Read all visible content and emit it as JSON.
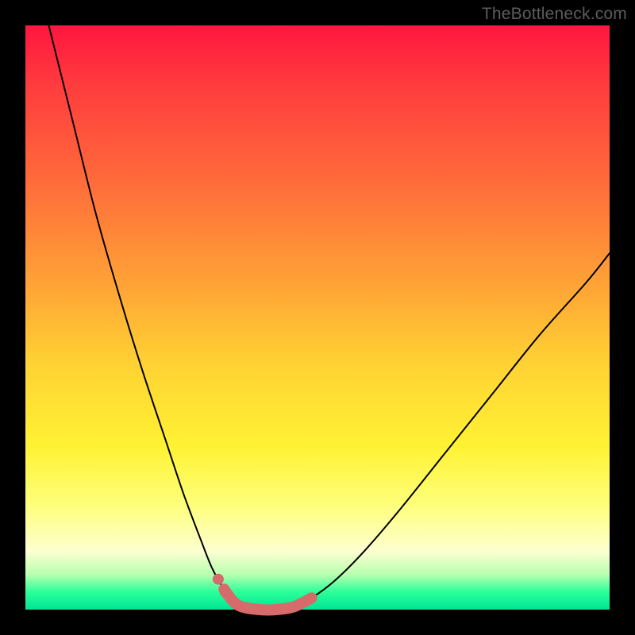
{
  "watermark": "TheBottleneck.com",
  "colors": {
    "frame_bg": "#000000",
    "curve": "#000000",
    "highlight": "#d76a6a",
    "gradient_top": "#ff163f",
    "gradient_bottom": "#00e593"
  },
  "chart_data": {
    "type": "line",
    "title": "",
    "xlabel": "",
    "ylabel": "",
    "xlim": [
      0,
      100
    ],
    "ylim": [
      0,
      100
    ],
    "series": [
      {
        "name": "left-curve",
        "x": [
          4,
          8,
          12,
          16,
          20,
          24,
          27,
          30,
          32,
          34,
          35.5,
          37
        ],
        "y": [
          100,
          84,
          68,
          54,
          41,
          29,
          20,
          12,
          7,
          3.5,
          1.5,
          0.5
        ]
      },
      {
        "name": "valley-floor",
        "x": [
          37,
          40,
          43,
          46
        ],
        "y": [
          0.5,
          0,
          0,
          0.5
        ]
      },
      {
        "name": "right-curve",
        "x": [
          46,
          49,
          53,
          58,
          64,
          72,
          80,
          88,
          96,
          100
        ],
        "y": [
          0.5,
          2,
          5,
          10,
          17,
          27,
          37,
          47,
          56,
          61
        ]
      }
    ],
    "highlight_segment": {
      "name": "optimal-zone",
      "x": [
        34,
        35.5,
        37,
        40,
        43,
        46,
        49
      ],
      "y": [
        3.5,
        1.5,
        0.5,
        0,
        0,
        0.5,
        2
      ]
    },
    "highlight_dots": [
      {
        "x": 33.0,
        "y": 5.2
      },
      {
        "x": 34.2,
        "y": 3.0
      }
    ]
  }
}
